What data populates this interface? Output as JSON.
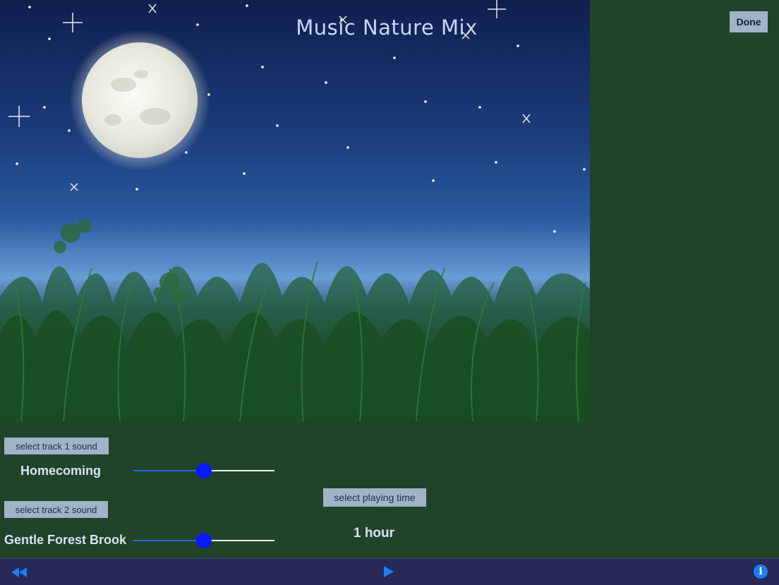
{
  "header": {
    "title": "Music Nature Mix",
    "done_label": "Done"
  },
  "scene": {
    "description_icon": "moonlit-meadow-image"
  },
  "tracks": [
    {
      "button_label": "select track 1 sound",
      "name": "Homecoming",
      "volume": 0.5
    },
    {
      "button_label": "select track 2 sound",
      "name": "Gentle Forest Brook",
      "volume": 0.5
    }
  ],
  "timer": {
    "button_label": "select playing time",
    "value": "1 hour"
  },
  "toolbar": {
    "rewind_icon": "rewind-icon",
    "play_icon": "play-icon",
    "info_icon": "info-icon",
    "info_glyph": "i"
  },
  "colors": {
    "panel_bg": "#21432a",
    "toolbar_bg": "#272958",
    "accent_blue": "#1e7cf2",
    "button_bg": "#9fb4c6"
  }
}
